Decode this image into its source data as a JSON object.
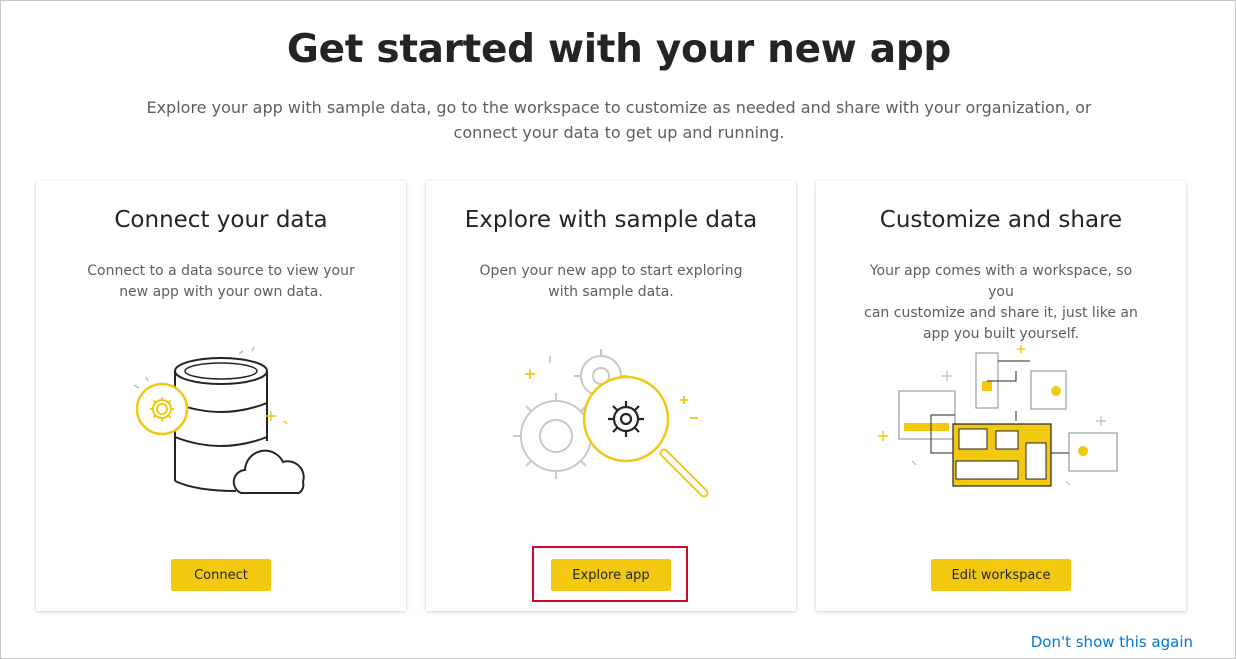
{
  "header": {
    "title": "Get started with your new app",
    "subtitle_line1": "Explore your app with sample data, go to the workspace to customize as needed and share with your organization, or",
    "subtitle_line2": "connect your data to get up and running."
  },
  "cards": [
    {
      "title": "Connect your data",
      "desc_line1": "Connect to a data source to view your",
      "desc_line2": "new app with your own data.",
      "desc_line3": "",
      "button": "Connect",
      "illustration": "database-cloud-illustration"
    },
    {
      "title": "Explore with sample data",
      "desc_line1": "Open your new app to start exploring",
      "desc_line2": "with sample data.",
      "desc_line3": "",
      "button": "Explore app",
      "illustration": "gears-magnifier-illustration",
      "highlighted": true
    },
    {
      "title": "Customize and share",
      "desc_line1": "Your app comes with a workspace, so you",
      "desc_line2": "can customize and share it, just like an",
      "desc_line3": "app you built yourself.",
      "button": "Edit workspace",
      "illustration": "workspace-dashboard-illustration"
    }
  ],
  "footer": {
    "dont_show_link": "Don't show this again"
  },
  "colors": {
    "accent": "#f2c811",
    "link": "#0078d4",
    "highlight": "#c8102e",
    "text": "#252423",
    "muted": "#605e5c"
  }
}
